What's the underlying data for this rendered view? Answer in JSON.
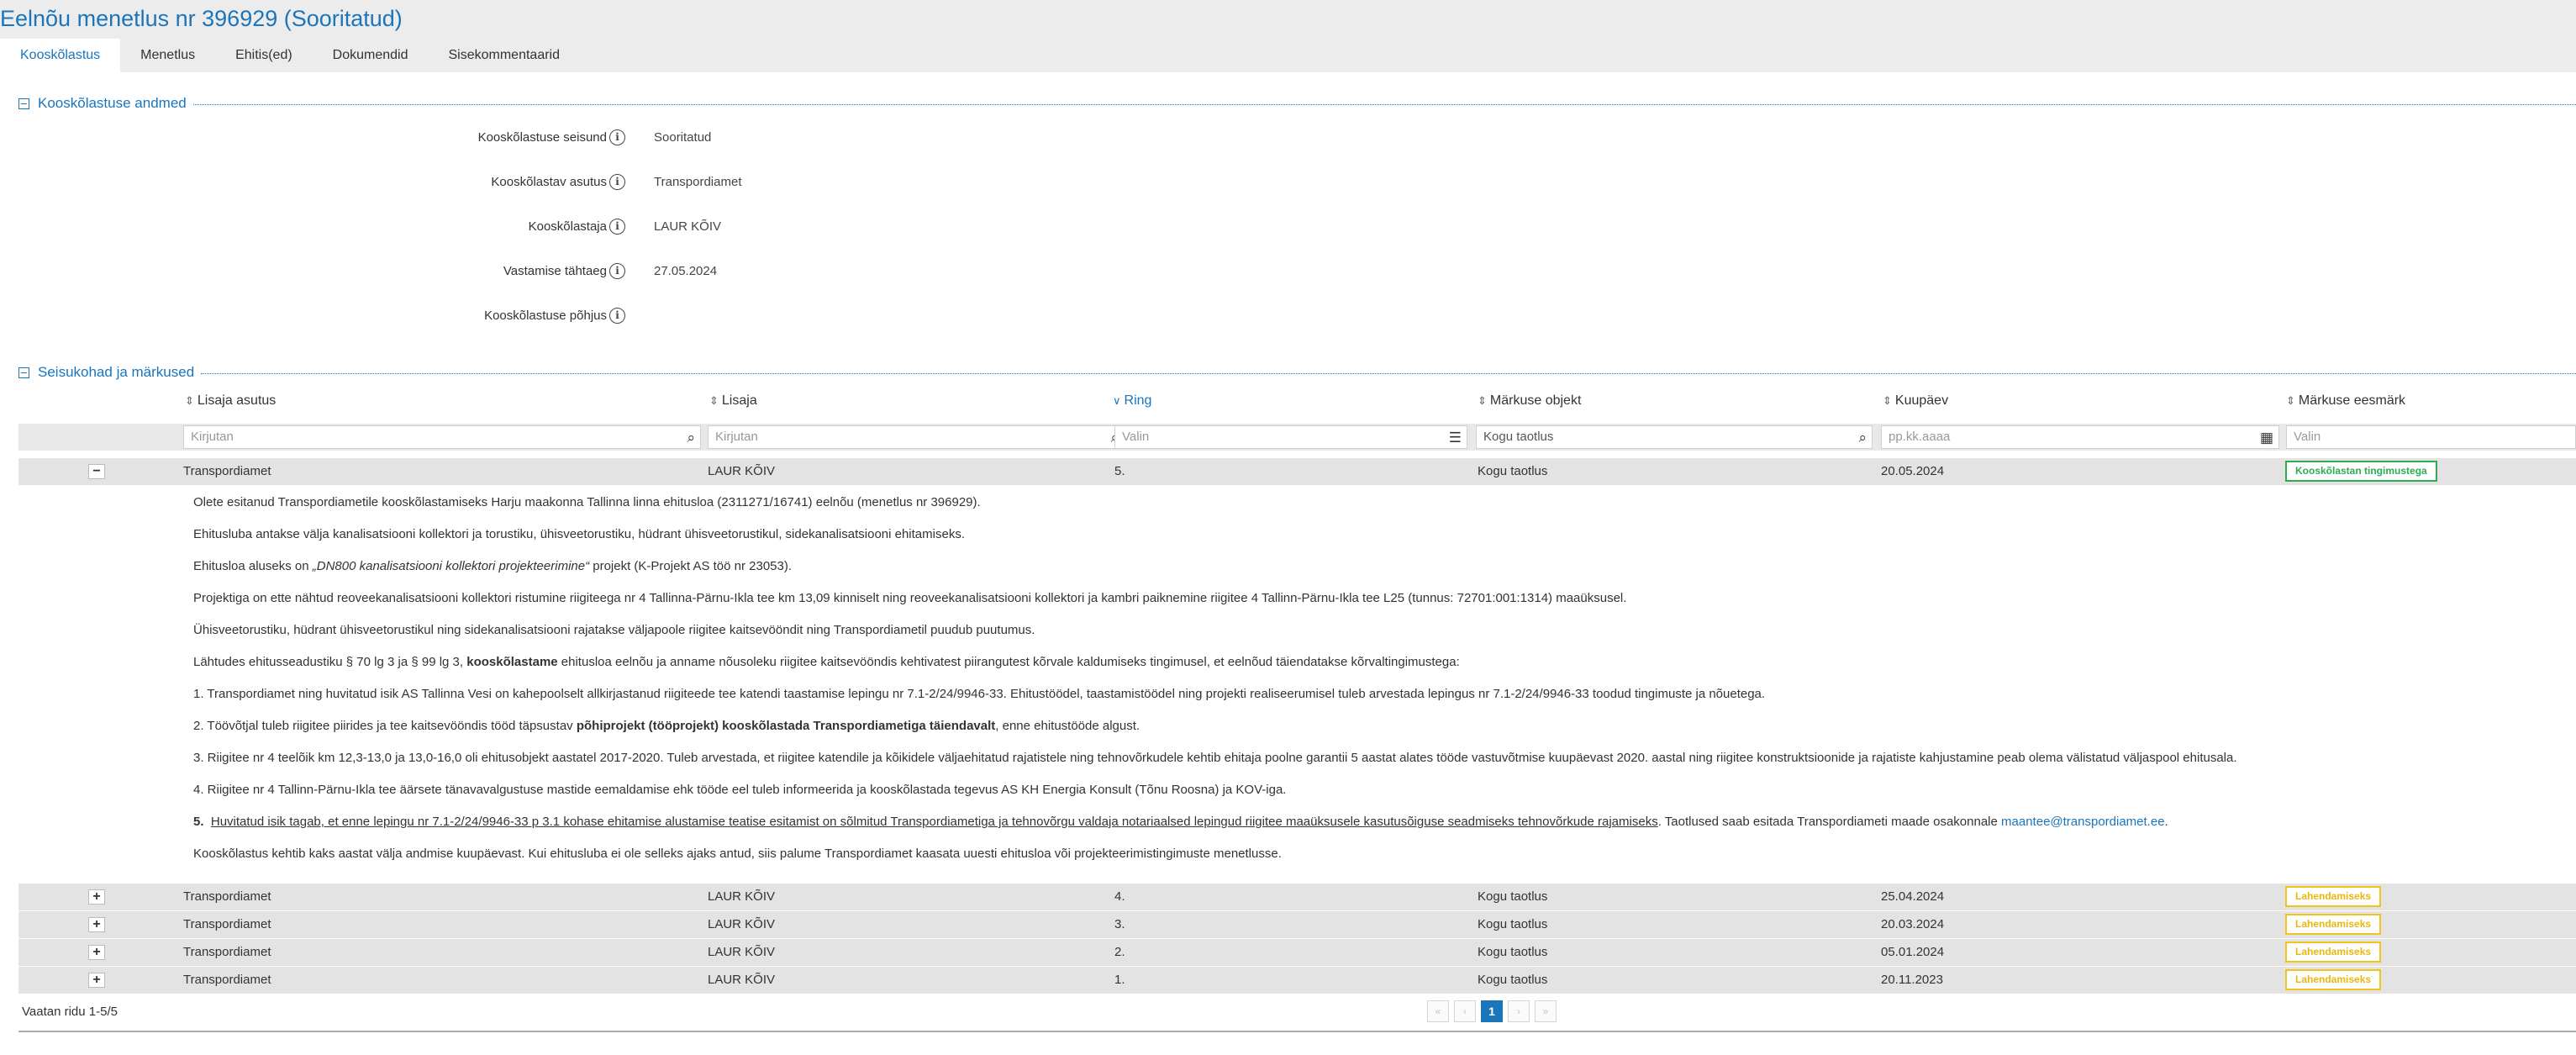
{
  "page_title": "Eelnõu menetlus nr 396929 (Sooritatud)",
  "tabs": [
    {
      "label": "Kooskõlastus",
      "active": true
    },
    {
      "label": "Menetlus"
    },
    {
      "label": "Ehitis(ed)"
    },
    {
      "label": "Dokumendid"
    },
    {
      "label": "Sisekommentaarid"
    }
  ],
  "section1": {
    "title": "Kooskõlastuse andmed",
    "fields": [
      {
        "label": "Kooskõlastuse seisund",
        "value": "Sooritatud"
      },
      {
        "label": "Kooskõlastav asutus",
        "value": "Transpordiamet"
      },
      {
        "label": "Kooskõlastaja",
        "value": "LAUR KÕIV"
      },
      {
        "label": "Vastamise tähtaeg",
        "value": "27.05.2024"
      },
      {
        "label": "Kooskõlastuse põhjus",
        "value": ""
      }
    ]
  },
  "section2": {
    "title": "Seisukohad ja märkused",
    "columns": [
      "Lisaja asutus",
      "Lisaja",
      "Ring",
      "Märkuse objekt",
      "Kuupäev",
      "Märkuse eesmärk"
    ],
    "filters": [
      "Kirjutan",
      "Kirjutan",
      "Valin",
      "Kogu taotlus",
      "pp.kk.aaaa",
      "Valin"
    ],
    "rows": [
      {
        "toggle": "−",
        "asutus": "Transpordiamet",
        "lisaja": "LAUR KÕIV",
        "ring": "5.",
        "objekt": "Kogu taotlus",
        "kuupaev": "20.05.2024",
        "eesmark": "Kooskõlastan tingimustega",
        "status": "green"
      },
      {
        "toggle": "+",
        "asutus": "Transpordiamet",
        "lisaja": "LAUR KÕIV",
        "ring": "4.",
        "objekt": "Kogu taotlus",
        "kuupaev": "25.04.2024",
        "eesmark": "Lahendamiseks",
        "status": "yellow"
      },
      {
        "toggle": "+",
        "asutus": "Transpordiamet",
        "lisaja": "LAUR KÕIV",
        "ring": "3.",
        "objekt": "Kogu taotlus",
        "kuupaev": "20.03.2024",
        "eesmark": "Lahendamiseks",
        "status": "yellow"
      },
      {
        "toggle": "+",
        "asutus": "Transpordiamet",
        "lisaja": "LAUR KÕIV",
        "ring": "2.",
        "objekt": "Kogu taotlus",
        "kuupaev": "05.01.2024",
        "eesmark": "Lahendamiseks",
        "status": "yellow"
      },
      {
        "toggle": "+",
        "asutus": "Transpordiamet",
        "lisaja": "LAUR KÕIV",
        "ring": "1.",
        "objekt": "Kogu taotlus",
        "kuupaev": "20.11.2023",
        "eesmark": "Lahendamiseks",
        "status": "yellow"
      }
    ],
    "detail": {
      "p1": "Olete esitanud Transpordiametile kooskõlastamiseks Harju maakonna Tallinna linna ehitusloa (2311271/16741) eelnõu (menetlus nr 396929).",
      "p2": "Ehitusluba antakse välja kanalisatsiooni kollektori ja torustiku, ühisveetorustiku, hüdrant ühisveetorustikul, sidekanalisatsiooni ehitamiseks.",
      "p3_a": "Ehitusloa aluseks on ",
      "p3_b": "„DN800 kanalisatsiooni kollektori projekteerimine“",
      "p3_c": " projekt (K-Projekt AS töö nr 23053).",
      "p4": "Projektiga on ette nähtud reoveekanalisatsiooni kollektori ristumine riigiteega nr 4 Tallinna-Pärnu-Ikla tee km 13,09 kinniselt ning reoveekanalisatsiooni kollektori ja kambri paiknemine riigitee 4 Tallinn-Pärnu-Ikla tee L25 (tunnus: 72701:001:1314) maaüksusel.",
      "p5": "Ühisveetorustiku, hüdrant ühisveetorustikul ning sidekanalisatsiooni rajatakse väljapoole riigitee kaitsevööndit ning Transpordiametil puudub puutumus.",
      "p6_a": "Lähtudes ehitusseadustiku § 70 lg 3 ja § 99 lg 3, ",
      "p6_b": "kooskõlastame",
      "p6_c": " ehitusloa eelnõu ja anname nõusoleku riigitee kaitsevööndis kehtivatest piirangutest kõrvale kaldumiseks tingimusel, et eelnõud täiendatakse kõrvaltingimustega:",
      "p7": "1. Transpordiamet ning huvitatud isik AS Tallinna Vesi on kahepoolselt allkirjastanud riigiteede tee katendi taastamise lepingu nr 7.1-2/24/9946-33. Ehitustöödel, taastamistöödel ning projekti realiseerumisel tuleb arvestada lepingus nr 7.1-2/24/9946-33 toodud tingimuste ja nõuetega.",
      "p8_a": "2. Töövõtjal tuleb riigitee piirides ja tee kaitsevööndis tööd täpsustav ",
      "p8_b": "põhiprojekt (tööprojekt) kooskõlastada Transpordiametiga täiendavalt",
      "p8_c": ", enne ehitustööde algust.",
      "p9": "3.  Riigitee nr 4 teelõik km 12,3-13,0 ja 13,0-16,0 oli ehitusobjekt aastatel 2017-2020. Tuleb arvestada, et riigitee katendile ja kõikidele väljaehitatud rajatistele ning tehnovõrkudele kehtib ehitaja poolne garantii 5 aastat alates tööde vastuvõtmise kuupäevast 2020. aastal ning riigitee konstruktsioonide ja rajatiste kahjustamine peab olema välistatud väljaspool ehitusala.",
      "p10": "4.  Riigitee nr 4 Tallinn-Pärnu-Ikla tee äärsete tänavavalgustuse mastide eemaldamise ehk tööde eel tuleb informeerida ja kooskõlastada tegevus AS KH Energia Konsult (Tõnu Roosna) ja KOV-iga.",
      "p11_num": "5.",
      "p11_u": "Huvitatud isik tagab, et enne lepingu nr 7.1-2/24/9946-33 p 3.1 kohase ehitamise alustamise teatise esitamist on sõlmitud Transpordiametiga ja tehnovõrgu valdaja notariaalsed lepingud riigitee maaüksusele kasutusõiguse seadmiseks tehnovõrkude rajamiseks",
      "p11_c": ". Taotlused saab esitada Transpordiameti maade osakonnale ",
      "p11_link": "maantee@transpordiamet.ee",
      "p11_end": ".",
      "p12": "Kooskõlastus kehtib kaks aastat välja andmise kuupäevast. Kui ehitusluba ei ole selleks ajaks antud, siis palume Transpordiamet kaasata uuesti ehitusloa või projekteerimistingimuste menetlusse."
    }
  },
  "footer": {
    "rows_info": "Vaatan ridu 1-5/5",
    "pager": {
      "first": "«",
      "prev": "‹",
      "current": "1",
      "next": "›",
      "last": "»"
    }
  },
  "colors": {
    "accent": "#1b75bb",
    "success": "#2eab53",
    "warning": "#f0c419"
  }
}
